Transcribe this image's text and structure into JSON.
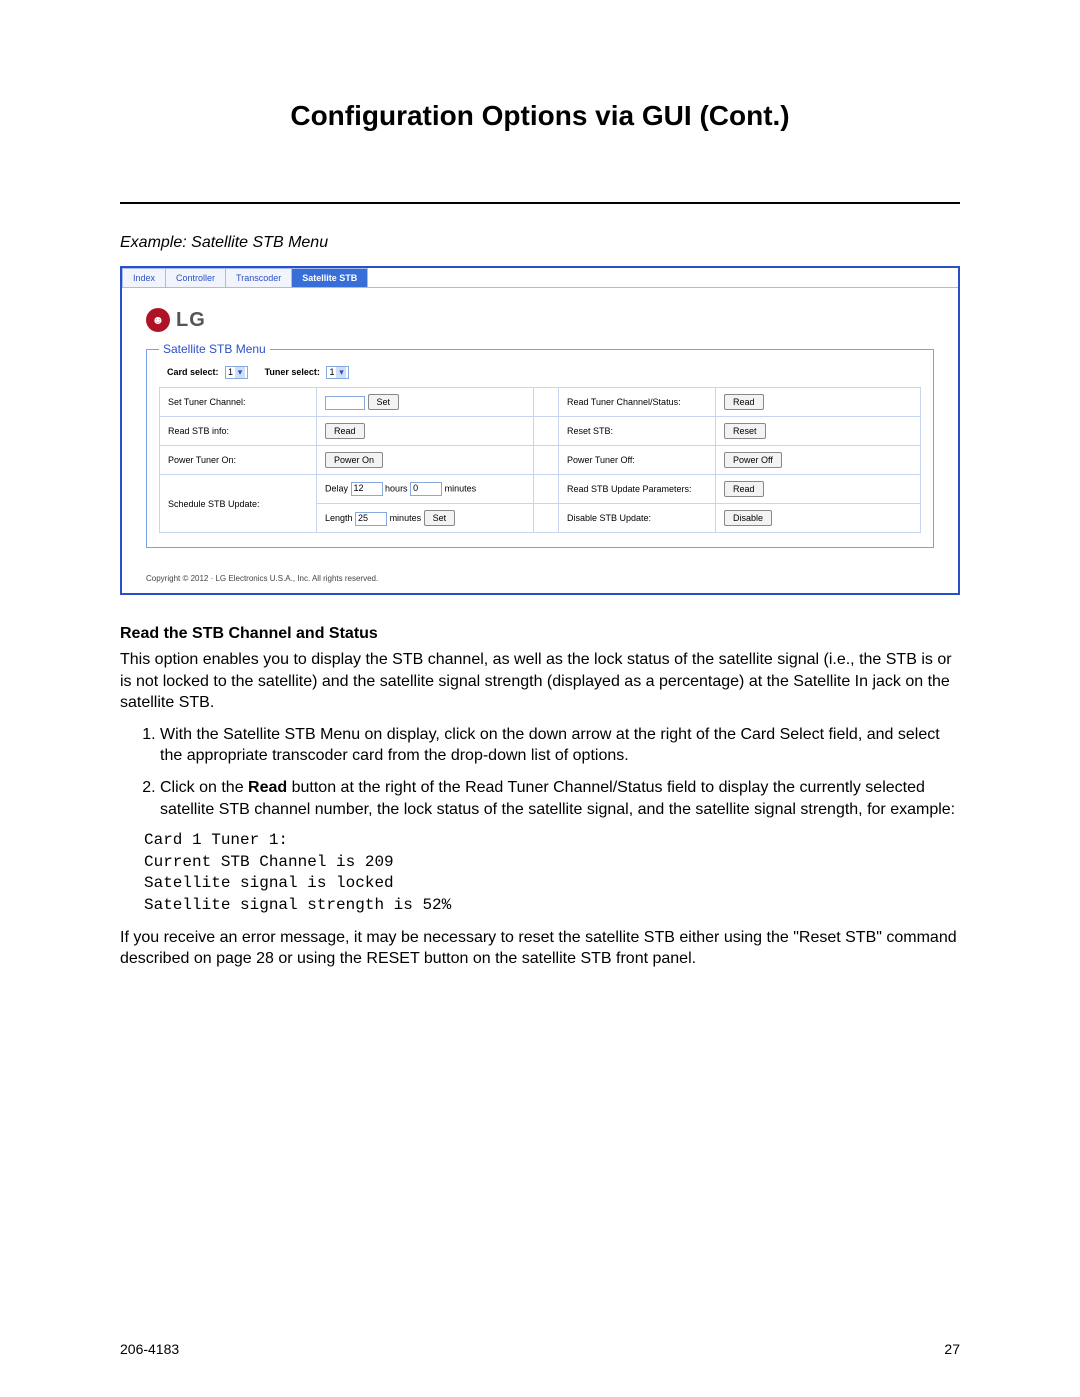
{
  "title": "Configuration Options via GUI (Cont.)",
  "example_caption": "Example: Satellite STB Menu",
  "gui": {
    "tabs": [
      "Index",
      "Controller",
      "Transcoder",
      "Satellite STB"
    ],
    "active_tab": 3,
    "logo_text": "LG",
    "logo_glyph": "⎈",
    "legend": "Satellite STB Menu",
    "card_select_label": "Card select:",
    "card_select_value": "1",
    "tuner_select_label": "Tuner select:",
    "tuner_select_value": "1",
    "rows_left": [
      {
        "label": "Set Tuner Channel:",
        "type": "input_set",
        "btn": "Set"
      },
      {
        "label": "Read STB info:",
        "type": "btn",
        "btn": "Read"
      },
      {
        "label": "Power Tuner On:",
        "type": "btn",
        "btn": "Power On"
      },
      {
        "label": "Schedule STB Update:",
        "type": "schedule",
        "delay_label": "Delay",
        "delay_val": "12",
        "hours": "hours",
        "min_val": "0",
        "minutes": "minutes",
        "length_label": "Length",
        "length_val": "25",
        "set": "Set"
      }
    ],
    "rows_right": [
      {
        "label": "Read Tuner Channel/Status:",
        "btn": "Read"
      },
      {
        "label": "Reset STB:",
        "btn": "Reset"
      },
      {
        "label": "Power Tuner Off:",
        "btn": "Power Off"
      },
      {
        "label": "Read STB Update Parameters:",
        "btn": "Read"
      },
      {
        "label": "Disable STB Update:",
        "btn": "Disable"
      }
    ],
    "copyright": "Copyright © 2012 · LG Electronics U.S.A., Inc. All rights reserved."
  },
  "section_head": "Read the STB Channel and Status",
  "para1": "This option enables you to display the STB channel, as well as the lock status of the satellite signal (i.e., the STB is or is not locked to the satellite) and the satellite signal strength (displayed as a percentage) at the Satellite In jack on the satellite STB.",
  "li1": "With the Satellite STB Menu on display, click on the down arrow at the right of the Card Select field, and select the appropriate transcoder card from the drop-down list of options.",
  "li2a": "Click on the ",
  "li2b": "Read",
  "li2c": " button at the right of the Read Tuner Channel/Status field to display the currently selected satellite STB channel number, the lock status of the satellite signal, and the satellite signal strength, for example:",
  "mono": "Card 1 Tuner 1:\nCurrent STB Channel is 209\nSatellite signal is locked\nSatellite signal strength is 52%",
  "para2": "If you receive an error message, it may be necessary to reset the satellite STB either using the \"Reset STB\" command described on page 28 or using the RESET button on the satellite STB front panel.",
  "doc_num": "206-4183",
  "page_num": "27"
}
